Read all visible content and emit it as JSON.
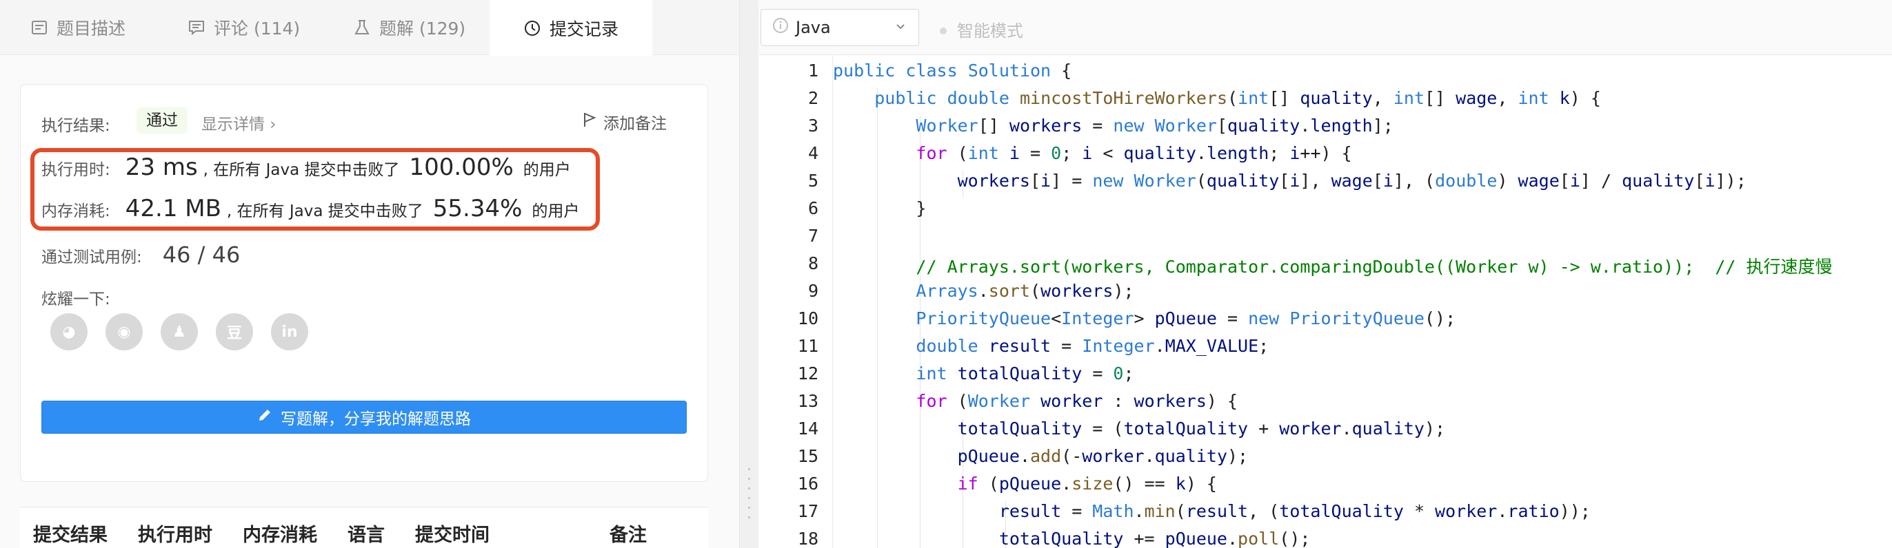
{
  "tabs": [
    {
      "label": "题目描述",
      "icon": "document-icon"
    },
    {
      "label": "评论 (114)",
      "icon": "comment-icon"
    },
    {
      "label": "题解 (129)",
      "icon": "flask-icon"
    },
    {
      "label": "提交记录",
      "icon": "clock-icon",
      "active": true
    }
  ],
  "result": {
    "label": "执行结果:",
    "status": "通过",
    "details_link": "显示详情 ›",
    "add_note": "添加备注",
    "runtime_label": "执行用时:",
    "runtime_value": "23 ms",
    "runtime_mid": ", 在所有 Java 提交中击败了",
    "runtime_percent": "100.00%",
    "runtime_suffix": "的用户",
    "memory_label": "内存消耗:",
    "memory_value": "42.1 MB",
    "memory_mid": ", 在所有 Java 提交中击败了",
    "memory_percent": "55.34%",
    "memory_suffix": "的用户",
    "tests_label": "通过测试用例:",
    "tests_value": "46  /  46",
    "share_label": "炫耀一下:",
    "share_icons": [
      "wechat-icon",
      "weibo-icon",
      "qq-icon",
      "douban-icon",
      "linkedin-icon"
    ],
    "share_glyphs": [
      "◕",
      "◉",
      "♟",
      "豆",
      "in"
    ],
    "write_button": "写题解，分享我的解题思路"
  },
  "table_headers": [
    "提交结果",
    "执行用时",
    "内存消耗",
    "语言",
    "提交时间",
    "备注"
  ],
  "editor": {
    "language": "Java",
    "smart_mode": "智能模式",
    "accent_color": "#e54b26",
    "button_color": "#2f8ef4",
    "line_numbers": [
      "1",
      "2",
      "3",
      "4",
      "5",
      "6",
      "7",
      "8",
      "9",
      "10",
      "11",
      "12",
      "13",
      "14",
      "15",
      "16",
      "17",
      "18"
    ],
    "lines": [
      "public class Solution {",
      "    public double mincostToHireWorkers(int[] quality, int[] wage, int k) {",
      "        Worker[] workers = new Worker[quality.length];",
      "        for (int i = 0; i < quality.length; i++) {",
      "            workers[i] = new Worker(quality[i], wage[i], (double) wage[i] / quality[i]);",
      "        }",
      "",
      "        // Arrays.sort(workers, Comparator.comparingDouble((Worker w) -> w.ratio));  // 执行速度慢",
      "        Arrays.sort(workers);",
      "        PriorityQueue<Integer> pQueue = new PriorityQueue();",
      "        double result = Integer.MAX_VALUE;",
      "        int totalQuality = 0;",
      "        for (Worker worker : workers) {",
      "            totalQuality = (totalQuality + worker.quality);",
      "            pQueue.add(-worker.quality);",
      "            if (pQueue.size() == k) {",
      "                result = Math.min(result, (totalQuality * worker.ratio));",
      "                totalQuality += pQueue.poll();"
    ]
  }
}
